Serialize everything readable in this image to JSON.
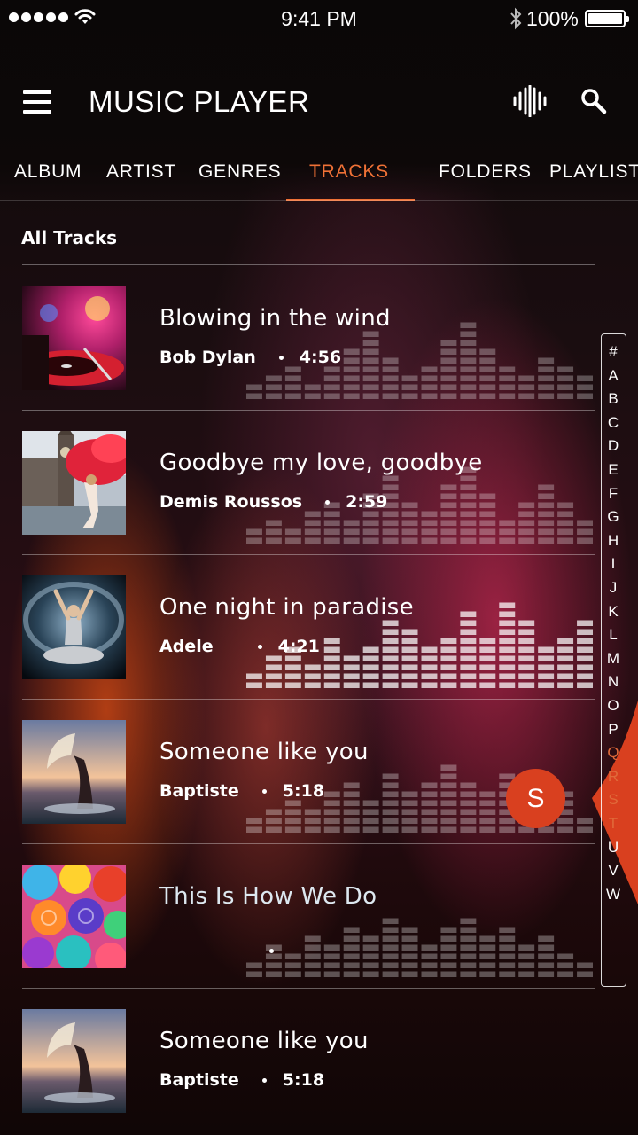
{
  "status_bar": {
    "time": "9:41 PM",
    "battery": "100%"
  },
  "header": {
    "title": "MUSIC PLAYER",
    "icons": [
      "menu-icon",
      "equalizer-icon",
      "search-icon"
    ]
  },
  "tabs": [
    {
      "label": "ALBUM",
      "active": false
    },
    {
      "label": "ARTIST",
      "active": false
    },
    {
      "label": "GENRES",
      "active": false
    },
    {
      "label": "TRACKS",
      "active": true
    },
    {
      "label": "FOLDERS",
      "active": false
    },
    {
      "label": "PLAYLIST",
      "active": false
    }
  ],
  "section_label": "All Tracks",
  "tracks": [
    {
      "title": "Blowing in the wind",
      "artist": "Bob Dylan",
      "duration": "4:56",
      "art": "turntable"
    },
    {
      "title": "Goodbye my love, goodbye",
      "artist": "Demis Roussos",
      "duration": "2:59",
      "art": "big-ben-red-smoke"
    },
    {
      "title": "One night in paradise",
      "artist": "Adele",
      "duration": "4:21",
      "art": "dancer-powder"
    },
    {
      "title": "Someone like you",
      "artist": "Baptiste",
      "duration": "5:18",
      "art": "hair-splash"
    },
    {
      "title": "This Is How We Do",
      "artist": "",
      "duration": "",
      "art": "rainbow-roses"
    },
    {
      "title": "Someone like you",
      "artist": "Baptiste",
      "duration": "5:18",
      "art": "hair-splash"
    }
  ],
  "index_letters": [
    "#",
    "A",
    "B",
    "C",
    "D",
    "E",
    "F",
    "G",
    "H",
    "I",
    "J",
    "K",
    "L",
    "M",
    "N",
    "O",
    "P",
    "Q",
    "R",
    "S",
    "T",
    "U",
    "V",
    "W"
  ],
  "index_highlight": [
    "Q",
    "R",
    "S",
    "T"
  ],
  "current_letter": "S",
  "colors": {
    "accent": "#ef7136",
    "bubble": "#d9401f"
  }
}
